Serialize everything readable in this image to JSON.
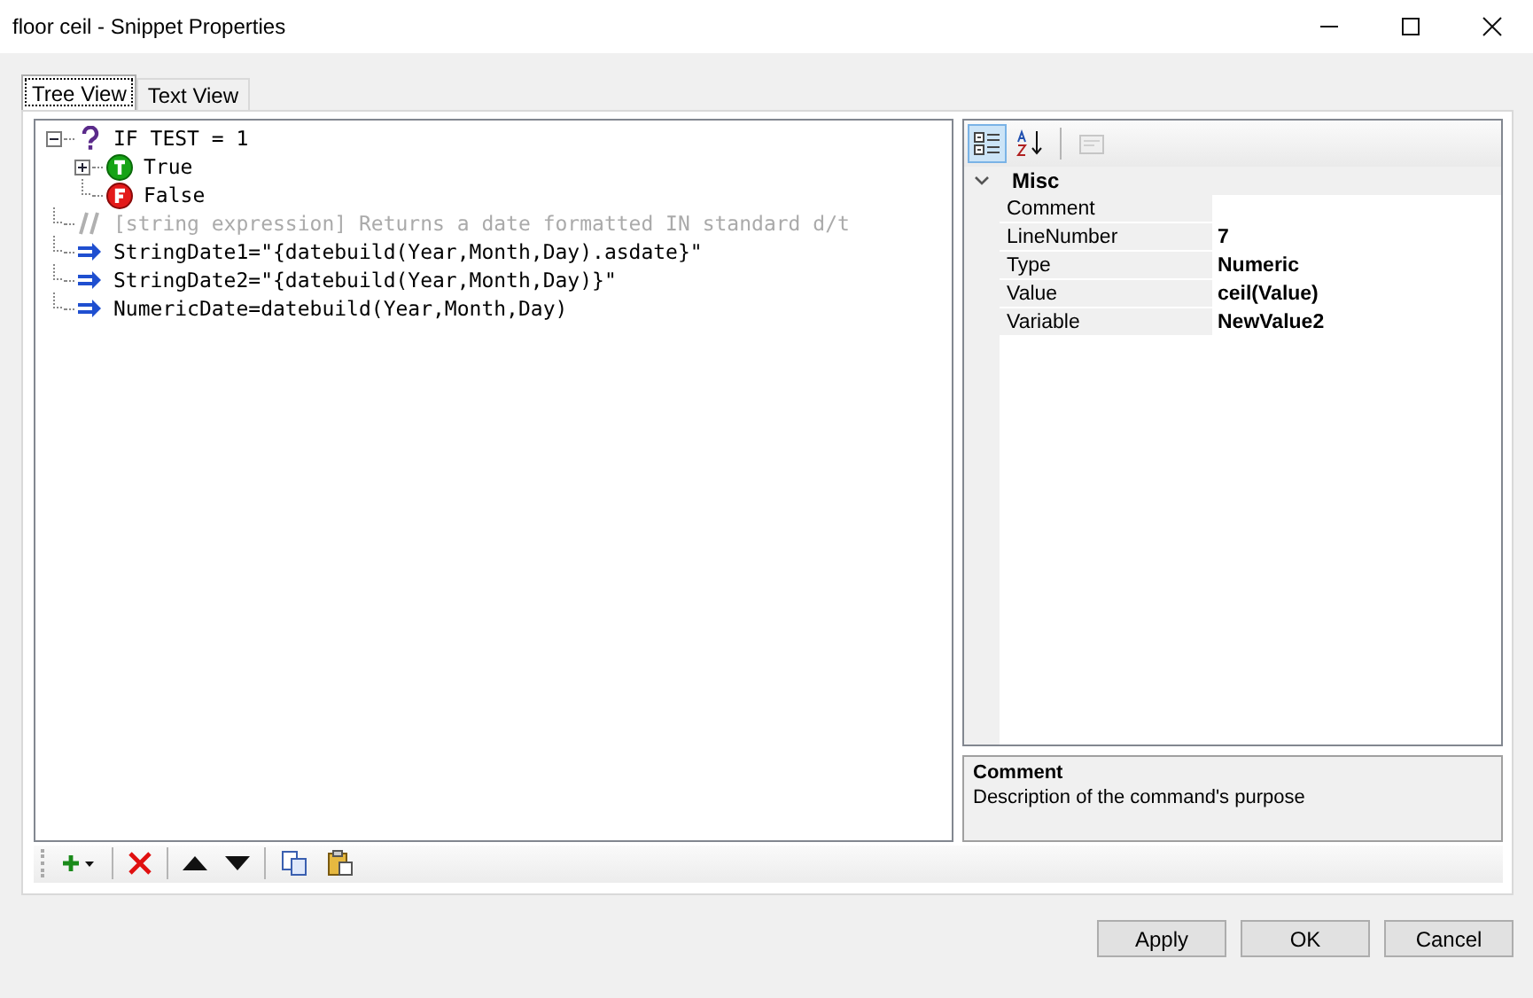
{
  "window": {
    "title": "floor ceil - Snippet Properties"
  },
  "tabs": [
    {
      "label": "Tree View",
      "selected": true
    },
    {
      "label": "Text View",
      "selected": false
    }
  ],
  "tree": [
    {
      "kind": "if",
      "label": "IF TEST = 1",
      "expanded": true,
      "children": [
        {
          "kind": "true",
          "label": "True",
          "expanded": false
        },
        {
          "kind": "false",
          "label": "False"
        }
      ]
    },
    {
      "kind": "comment",
      "label": "[string expression] Returns a date formatted IN standard d/t"
    },
    {
      "kind": "assign",
      "label": "StringDate1=\"{datebuild(Year,Month,Day).asdate}\""
    },
    {
      "kind": "assign",
      "label": "StringDate2=\"{datebuild(Year,Month,Day)}\""
    },
    {
      "kind": "assign",
      "label": "NumericDate=datebuild(Year,Month,Day)"
    }
  ],
  "property_toolbar": [
    {
      "kind": "categorized",
      "selected": true,
      "disabled": false
    },
    {
      "kind": "alphabetical",
      "selected": false,
      "disabled": false
    },
    {
      "kind": "pages",
      "selected": false,
      "disabled": true
    }
  ],
  "properties": {
    "category": "Misc",
    "expanded": true,
    "rows": [
      {
        "name": "Comment"
      },
      {
        "name": "LineNumber",
        "value": "7"
      },
      {
        "name": "Type",
        "value": "Numeric"
      },
      {
        "name": "Value",
        "value": "ceil(Value)"
      },
      {
        "name": "Variable",
        "value": "NewValue2"
      }
    ]
  },
  "help": {
    "title": "Comment",
    "description": "Description of the command's purpose"
  },
  "buttons": [
    "Apply",
    "OK",
    "Cancel"
  ]
}
